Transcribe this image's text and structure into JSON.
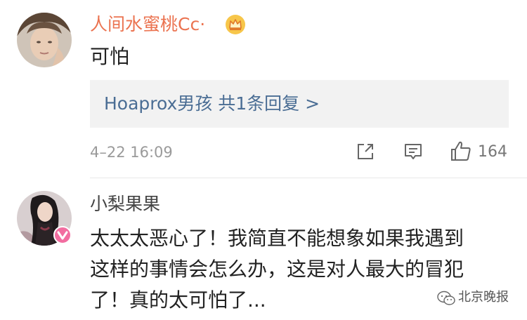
{
  "comments": [
    {
      "username": "人间水蜜桃Cc·",
      "text": "可怕",
      "replies_preview": "Hoaprox男孩  共1条回复 >",
      "time": "4–22 16:09",
      "likes": "164",
      "icons": [
        "avatar",
        "crown-icon",
        "share-icon",
        "comment-icon",
        "like-icon"
      ]
    },
    {
      "username": "小梨果果",
      "text_lines": [
        "太太太恶心了！我简直不能想象如果我遇到",
        "这样的事情会怎么办，这是对人最大的冒犯",
        "了！真的太可怕了..."
      ],
      "icons": [
        "avatar",
        "verified-v-badge"
      ]
    }
  ],
  "watermark": "北京晚报",
  "colors": {
    "username_vip": "#eb7350",
    "username": "#444444",
    "reply_link": "#4a6d94",
    "reply_bg": "#f2f2f2",
    "meta": "#9a9a9a",
    "badge": "#f26da0"
  }
}
